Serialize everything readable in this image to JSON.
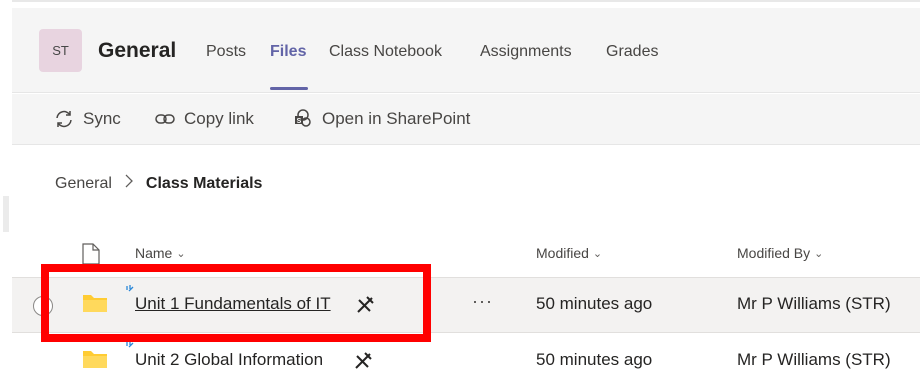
{
  "header": {
    "avatar_initials": "ST",
    "channel_title": "General",
    "tabs": [
      {
        "label": "Posts",
        "active": false
      },
      {
        "label": "Files",
        "active": true
      },
      {
        "label": "Class Notebook",
        "active": false
      },
      {
        "label": "Assignments",
        "active": false
      },
      {
        "label": "Grades",
        "active": false
      }
    ]
  },
  "toolbar": {
    "sync_label": "Sync",
    "copy_link_label": "Copy link",
    "open_sharepoint_label": "Open in SharePoint"
  },
  "breadcrumb": {
    "root": "General",
    "separator": ">",
    "current": "Class Materials"
  },
  "table": {
    "columns": {
      "name": "Name",
      "modified": "Modified",
      "modified_by": "Modified By"
    },
    "rows": [
      {
        "name": "Unit 1 Fundamentals of IT",
        "modified": "50 minutes ago",
        "modified_by": "Mr P Williams (STR)",
        "selected": true
      },
      {
        "name": "Unit 2 Global Information",
        "modified": "50 minutes ago",
        "modified_by": "Mr P Williams (STR)",
        "selected": false
      }
    ],
    "more_label": "···"
  },
  "colors": {
    "accent": "#6264a7",
    "folder": "#ffcc33",
    "highlight": "#ff0000",
    "avatar_bg": "#e8d4e0"
  },
  "icons": [
    "sync-icon",
    "link-icon",
    "sharepoint-icon",
    "file-icon",
    "folder-icon",
    "pin-icon",
    "chevron-right-icon"
  ]
}
